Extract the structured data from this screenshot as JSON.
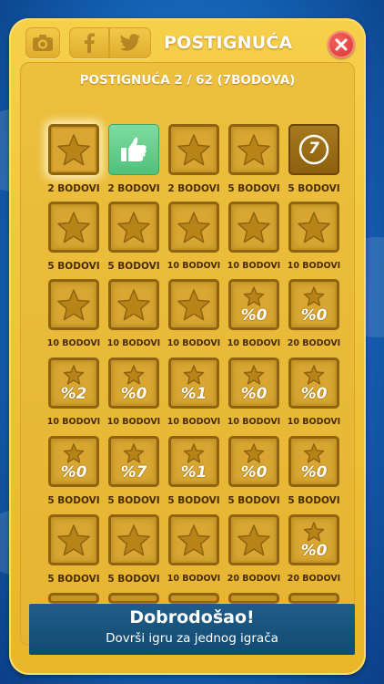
{
  "header": {
    "title": "POSTIGNUĆA",
    "buttons": [
      {
        "name": "camera-icon"
      },
      {
        "name": "facebook-icon"
      },
      {
        "name": "twitter-icon"
      },
      {
        "name": "close-icon"
      }
    ]
  },
  "summary": "POSTIGNUĆA 2 / 62 (7BODOVA)",
  "colors": {
    "panel": "#eebc36",
    "banner": "#154f79",
    "close": "#e03a33",
    "label": "#4a2d00"
  },
  "achievements": [
    {
      "kind": "star",
      "label": "2 BODOVI",
      "selected": true
    },
    {
      "kind": "thumbs",
      "label": "2 BODOVI"
    },
    {
      "kind": "star",
      "label": "2 BODOVI"
    },
    {
      "kind": "star",
      "label": "5 BODOVI"
    },
    {
      "kind": "seven",
      "label": "5 BODOVI",
      "glyph": "7"
    },
    {
      "kind": "star",
      "label": "5 BODOVI"
    },
    {
      "kind": "star",
      "label": "5 BODOVI"
    },
    {
      "kind": "star",
      "label": "10 BODOVI"
    },
    {
      "kind": "star",
      "label": "10 BODOVI"
    },
    {
      "kind": "star",
      "label": "10 BODOVI"
    },
    {
      "kind": "star",
      "label": "10 BODOVI"
    },
    {
      "kind": "star",
      "label": "10 BODOVI"
    },
    {
      "kind": "star",
      "label": "10 BODOVI"
    },
    {
      "kind": "pct",
      "pct": "%0",
      "label": "10 BODOVI"
    },
    {
      "kind": "pct",
      "pct": "%0",
      "label": "20 BODOVI"
    },
    {
      "kind": "pct",
      "pct": "%2",
      "label": "10 BODOVI"
    },
    {
      "kind": "pct",
      "pct": "%0",
      "label": "10 BODOVI"
    },
    {
      "kind": "pct",
      "pct": "%1",
      "label": "10 BODOVI"
    },
    {
      "kind": "pct",
      "pct": "%0",
      "label": "10 BODOVI"
    },
    {
      "kind": "pct",
      "pct": "%0",
      "label": "10 BODOVI"
    },
    {
      "kind": "pct",
      "pct": "%0",
      "label": "5 BODOVI"
    },
    {
      "kind": "pct",
      "pct": "%7",
      "label": "5 BODOVI"
    },
    {
      "kind": "pct",
      "pct": "%1",
      "label": "5 BODOVI"
    },
    {
      "kind": "pct",
      "pct": "%0",
      "label": "5 BODOVI"
    },
    {
      "kind": "pct",
      "pct": "%0",
      "label": "5 BODOVI"
    },
    {
      "kind": "star",
      "label": "5 BODOVI"
    },
    {
      "kind": "star",
      "label": "5 BODOVI"
    },
    {
      "kind": "star",
      "label": "10 BODOVI"
    },
    {
      "kind": "star",
      "label": "20 BODOVI"
    },
    {
      "kind": "pct",
      "pct": "%0",
      "label": "20 BODOVI"
    }
  ],
  "banner": {
    "title": "Dobrodošao!",
    "subtitle": "Dovrši igru za jednog igrača"
  }
}
